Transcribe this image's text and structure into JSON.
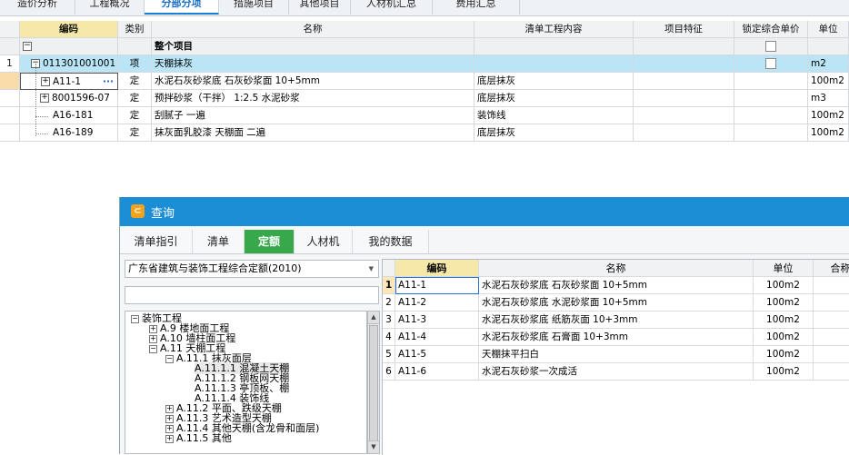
{
  "top_tabs": [
    "造价分析",
    "工程概况",
    "分部分项",
    "措施项目",
    "其他项目",
    "人材机汇总",
    "费用汇总"
  ],
  "top_tab_active": "分部分项",
  "main_grid": {
    "headers": {
      "code": "编码",
      "type": "类别",
      "name": "名称",
      "content": "清单工程内容",
      "feature": "项目特征",
      "lock": "锁定综合单价",
      "unit": "单位"
    },
    "group_row": {
      "name": "整个项目",
      "collapse": "−"
    },
    "rows": [
      {
        "num": "1",
        "code": "011301001001",
        "type": "项",
        "name": "天棚抹灰",
        "content": "",
        "unit": "m2",
        "box": "−"
      },
      {
        "num": "",
        "code": "A11-1",
        "type": "定",
        "name": "水泥石灰砂浆底 石灰砂浆面 10+5mm",
        "content": "底层抹灰",
        "unit": "100m2",
        "box": "+",
        "more": "···"
      },
      {
        "num": "",
        "code": "8001596-07",
        "type": "定",
        "name": "预拌砂浆（干拌） 1:2.5 水泥砂浆",
        "content": "底层抹灰",
        "unit": "m3",
        "box": "+"
      },
      {
        "num": "",
        "code": "A16-181",
        "type": "定",
        "name": "刮腻子 一遍",
        "content": "装饰线",
        "unit": "100m2"
      },
      {
        "num": "",
        "code": "A16-189",
        "type": "定",
        "name": "抹灰面乳胶漆 天棚面 二遍",
        "content": "底层抹灰",
        "unit": "100m2"
      }
    ]
  },
  "dialog": {
    "title": "查询",
    "icon": "query-app-icon",
    "tabs": [
      "清单指引",
      "清单",
      "定额",
      "人材机",
      "我的数据"
    ],
    "active_tab": "定额",
    "library_select": "广东省建筑与装饰工程综合定额(2010)",
    "search_value": "",
    "tree": [
      {
        "label": "装饰工程",
        "box": "−"
      },
      {
        "label": "A.9  楼地面工程",
        "box": "+"
      },
      {
        "label": "A.10  墙柱面工程",
        "box": "+"
      },
      {
        "label": "A.11  天棚工程",
        "box": "−"
      },
      {
        "label": "A.11.1  抹灰面层",
        "box": "−"
      },
      {
        "label": "A.11.1.1  混凝土天棚"
      },
      {
        "label": "A.11.1.2  钢板网天棚"
      },
      {
        "label": "A.11.1.3  亭顶板、棚"
      },
      {
        "label": "A.11.1.4  装饰线"
      },
      {
        "label": "A.11.2  平面、跌级天棚",
        "box": "+"
      },
      {
        "label": "A.11.3  艺术造型天棚",
        "box": "+"
      },
      {
        "label": "A.11.4  其他天棚(含龙骨和面层)",
        "box": "+"
      },
      {
        "label": "A.11.5  其他",
        "box": "+"
      }
    ],
    "result_headers": {
      "code": "编码",
      "name": "名称",
      "unit": "单位",
      "price": "合称"
    },
    "results": [
      {
        "num": "1",
        "code": "A11-1",
        "name": "水泥石灰砂浆底 石灰砂浆面 10+5mm",
        "unit": "100m2"
      },
      {
        "num": "2",
        "code": "A11-2",
        "name": "水泥石灰砂浆底 水泥砂浆面 10+5mm",
        "unit": "100m2"
      },
      {
        "num": "3",
        "code": "A11-3",
        "name": "水泥石灰砂浆底 纸筋灰面 10+3mm",
        "unit": "100m2"
      },
      {
        "num": "4",
        "code": "A11-4",
        "name": "水泥石灰砂浆底 石膏面 10+3mm",
        "unit": "100m2"
      },
      {
        "num": "5",
        "code": "A11-5",
        "name": "天棚抹平扫白",
        "unit": "100m2"
      },
      {
        "num": "6",
        "code": "A11-6",
        "name": "水泥石灰砂浆一次成活",
        "unit": "100m2"
      }
    ]
  }
}
